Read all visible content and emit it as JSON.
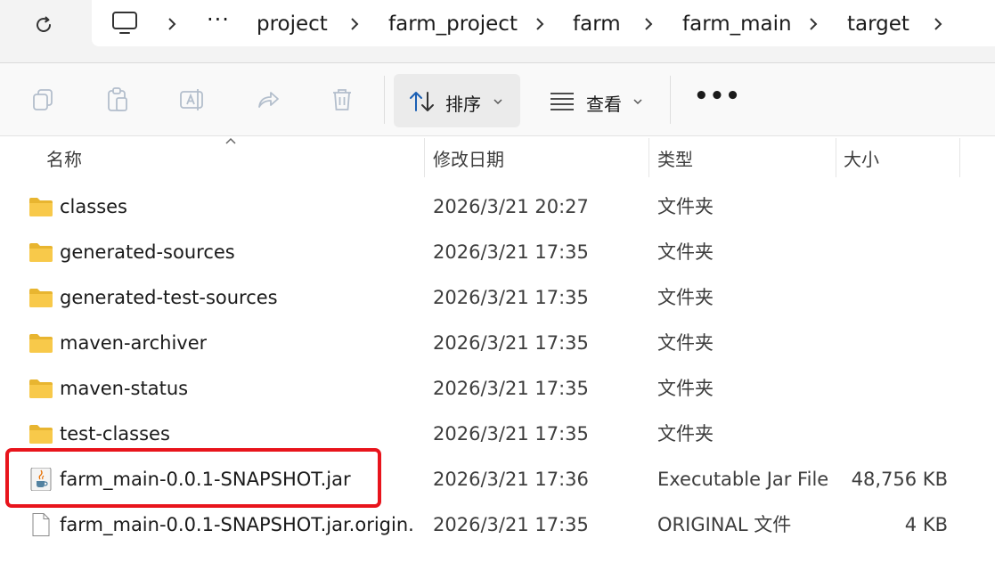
{
  "breadcrumb": {
    "overflow_label": "···",
    "items": [
      "project",
      "farm_project",
      "farm",
      "farm_main",
      "target"
    ]
  },
  "commandbar": {
    "sort_label": "排序",
    "view_label": "查看",
    "more_label": "•••"
  },
  "columns": {
    "name": "名称",
    "date": "修改日期",
    "type": "类型",
    "size": "大小"
  },
  "files": [
    {
      "name": "classes",
      "date": "2026/3/21 20:27",
      "type": "文件夹",
      "size": "",
      "icon": "folder-icon"
    },
    {
      "name": "generated-sources",
      "date": "2026/3/21 17:35",
      "type": "文件夹",
      "size": "",
      "icon": "folder-icon"
    },
    {
      "name": "generated-test-sources",
      "date": "2026/3/21 17:35",
      "type": "文件夹",
      "size": "",
      "icon": "folder-icon"
    },
    {
      "name": "maven-archiver",
      "date": "2026/3/21 17:35",
      "type": "文件夹",
      "size": "",
      "icon": "folder-icon"
    },
    {
      "name": "maven-status",
      "date": "2026/3/21 17:35",
      "type": "文件夹",
      "size": "",
      "icon": "folder-icon"
    },
    {
      "name": "test-classes",
      "date": "2026/3/21 17:35",
      "type": "文件夹",
      "size": "",
      "icon": "folder-icon"
    },
    {
      "name": "farm_main-0.0.1-SNAPSHOT.jar",
      "date": "2026/3/21 17:36",
      "type": "Executable Jar File",
      "size": "48,756 KB",
      "icon": "java-jar-icon"
    },
    {
      "name": "farm_main-0.0.1-SNAPSHOT.jar.origin...",
      "date": "2026/3/21 17:35",
      "type": "ORIGINAL 文件",
      "size": "4 KB",
      "icon": "blank-file-icon"
    }
  ],
  "colors": {
    "highlight": "#e8141c",
    "folder": "#f8c94a"
  }
}
